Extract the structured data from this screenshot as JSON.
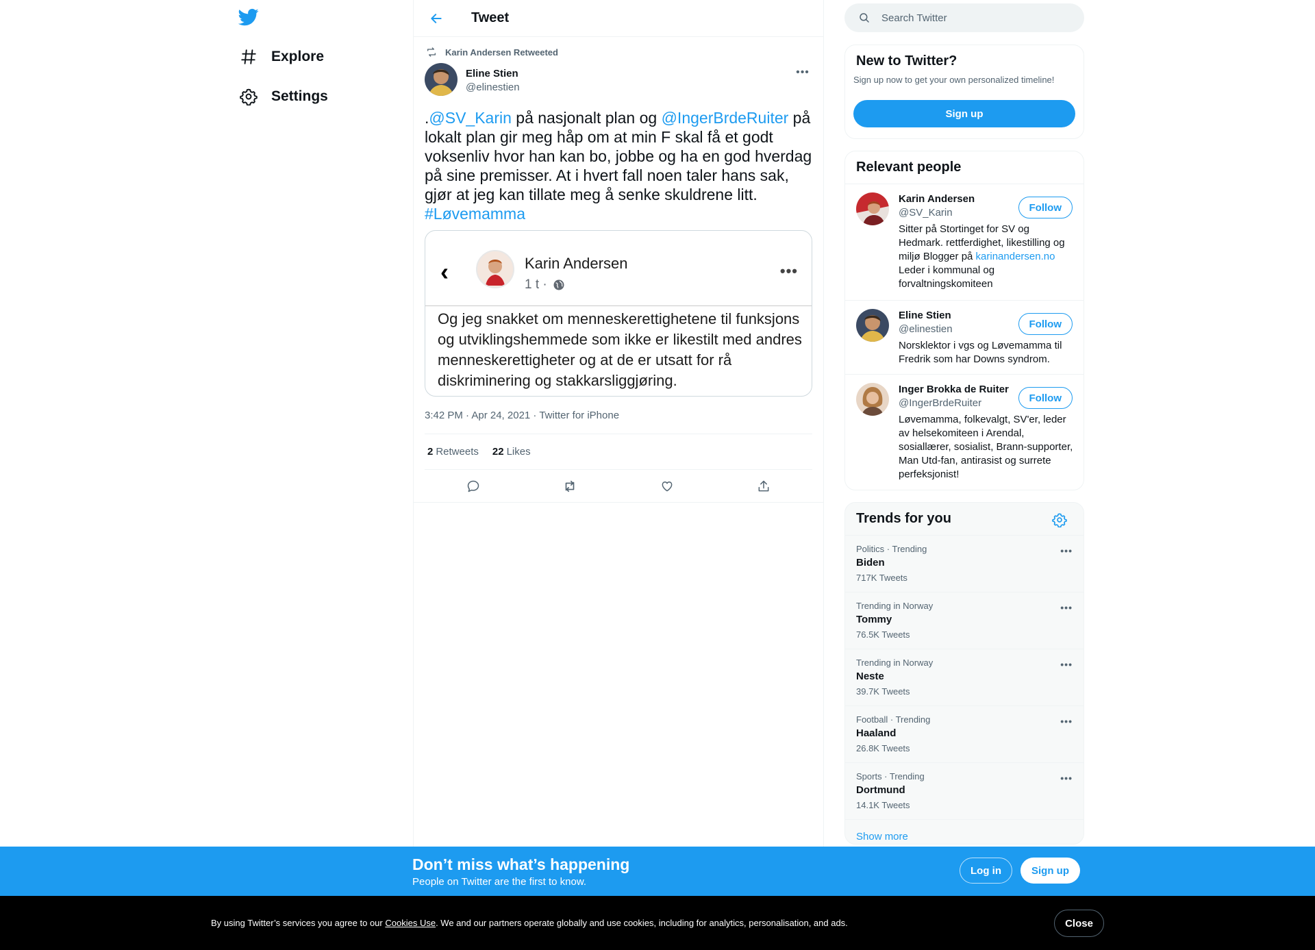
{
  "nav": {
    "logo_icon": "twitter-bird-icon",
    "items": [
      {
        "label": "Explore",
        "icon": "hashtag-icon"
      },
      {
        "label": "Settings",
        "icon": "gear-icon"
      }
    ]
  },
  "header": {
    "title": "Tweet",
    "back_icon": "arrow-left-icon"
  },
  "tweet": {
    "retweeted_by": "Karin Andersen Retweeted",
    "author_name": "Eline Stien",
    "author_handle": "@elinestien",
    "text_parts": [
      {
        "text": ".",
        "link": false
      },
      {
        "text": "@SV_Karin",
        "link": true
      },
      {
        "text": " på nasjonalt plan og ",
        "link": false
      },
      {
        "text": "@IngerBrdeRuiter",
        "link": true
      },
      {
        "text": " på lokalt plan gir meg håp om at min F skal få et godt voksenliv hvor han kan bo, jobbe og ha en god hverdag på sine premisser.  At i hvert fall noen taler hans sak, gjør at jeg kan tillate meg å senke skuldrene litt. ",
        "link": false
      },
      {
        "text": "#Løvemamma",
        "link": true
      }
    ],
    "media": {
      "name": "Karin Andersen",
      "time": "1 t ·",
      "body": "Og jeg snakket om menneskerettighetene til funksjons og utviklingshemmede som ikke er likestilt med andres menneskerettigheter og at de er utsatt for rå diskriminering og stakkarsliggjøring."
    },
    "meta": "3:42 PM · Apr 24, 2021 · Twitter for iPhone",
    "retweets_count": "2",
    "retweets_label": "Retweets",
    "likes_count": "22",
    "likes_label": "Likes"
  },
  "search": {
    "placeholder": "Search Twitter"
  },
  "new_to_twitter": {
    "title": "New to Twitter?",
    "subtitle": "Sign up now to get your own personalized timeline!",
    "button": "Sign up"
  },
  "relevant_people": {
    "title": "Relevant people",
    "follow_label": "Follow",
    "people": [
      {
        "name": "Karin Andersen",
        "handle": "@SV_Karin",
        "bio_before": "Sitter på Stortinget for SV og Hedmark. rettferdighet, likestilling og miljø Blogger på ",
        "bio_link": "karinandersen.no",
        "bio_after": " Leder i kommunal og forvaltningskomiteen"
      },
      {
        "name": "Eline Stien",
        "handle": "@elinestien",
        "bio_before": "Norsklektor i vgs og Løvemamma til Fredrik som har Downs syndrom.",
        "bio_link": "",
        "bio_after": ""
      },
      {
        "name": "Inger Brokka de Ruiter",
        "handle": "@IngerBrdeRuiter",
        "bio_before": "Løvemamma, folkevalgt, SV'er, leder av helsekomiteen i Arendal, sosiallærer, sosialist, Brann-supporter, Man Utd-fan, antirasist og surrete perfeksjonist!",
        "bio_link": "",
        "bio_after": ""
      }
    ]
  },
  "trends": {
    "title": "Trends for you",
    "items": [
      {
        "meta": "Politics · Trending",
        "name": "Biden",
        "count": "717K Tweets"
      },
      {
        "meta": "Trending in Norway",
        "name": "Tommy",
        "count": "76.5K Tweets"
      },
      {
        "meta": "Trending in Norway",
        "name": "Neste",
        "count": "39.7K Tweets"
      },
      {
        "meta": "Football · Trending",
        "name": "Haaland",
        "count": "26.8K Tweets"
      },
      {
        "meta": "Sports · Trending",
        "name": "Dortmund",
        "count": "14.1K Tweets"
      }
    ],
    "show_more": "Show more"
  },
  "banner": {
    "title": "Don’t miss what’s happening",
    "subtitle": "People on Twitter are the first to know.",
    "login": "Log in",
    "signup": "Sign up"
  },
  "cookie": {
    "text_before": "By using Twitter’s services you agree to our ",
    "link": "Cookies Use",
    "text_after": ". We and our partners operate globally and use cookies, including for analytics, personalisation, and ads.",
    "close": "Close"
  },
  "colors": {
    "accent": "#1d9bf0",
    "text_primary": "#0f1419",
    "text_secondary": "#536471",
    "cookie_bg": "#000000"
  }
}
